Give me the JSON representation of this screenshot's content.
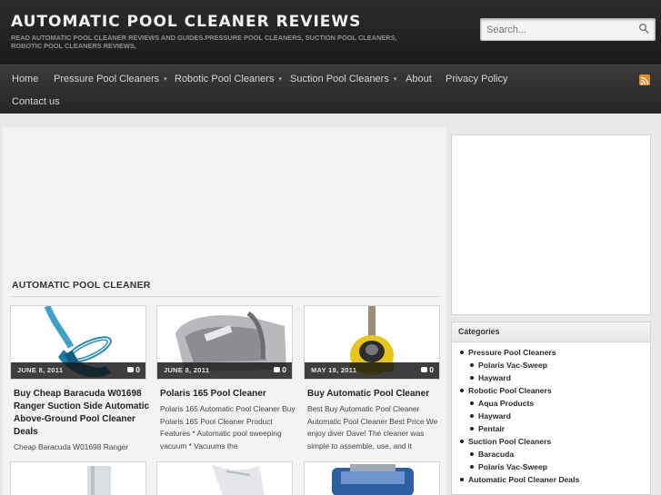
{
  "site": {
    "title": "AUTOMATIC POOL CLEANER REVIEWS",
    "description": "READ AUTOMATIC POOL CLEANER REVIEWS AND GUIDES.PRESSURE POOL CLEANERS, SUCTION POOL CLEANERS, ROBOTIC POOL CLEANERS REVIEWS,"
  },
  "search": {
    "placeholder": "Search..."
  },
  "nav": {
    "items": [
      {
        "label": "Home"
      },
      {
        "label": "Pressure Pool Cleaners"
      },
      {
        "label": "Robotic Pool Cleaners"
      },
      {
        "label": "Suction Pool Cleaners"
      },
      {
        "label": "About"
      },
      {
        "label": "Privacy Policy"
      },
      {
        "label": "Contact us"
      }
    ],
    "dropdown_caret": "▾",
    "rss_icon": "rss-icon"
  },
  "section": {
    "title": "AUTOMATIC POOL CLEANER"
  },
  "posts": [
    {
      "date": "JUNE 8, 2011",
      "comments": "0",
      "title": "Buy Cheap Baracuda W01698 Ranger Suction Side Automatic Above-Ground Pool Cleaner Deals",
      "excerpt": "Cheap Baracuda W01698 Ranger"
    },
    {
      "date": "JUNE 8, 2011",
      "comments": "0",
      "title": "Polaris 165 Pool Cleaner",
      "excerpt": "Polaris 165 Automatic Pool Cleaner Buy Polaris 165 Pool Cleaner Product Features * Automatic pool sweeping vacuum * Vacuums the"
    },
    {
      "date": "MAY 19, 2011",
      "comments": "0",
      "title": "Buy Automatic Pool Cleaner",
      "excerpt": "Best Buy Automatic Pool Cleaner Automatic Pool Cleaner Best Price We enjoy diver Dave! The cleaner was simple to assemble, use, and it"
    }
  ],
  "categories": {
    "heading": "Categories",
    "items": [
      {
        "label": "Pressure Pool Cleaners",
        "level": 0
      },
      {
        "label": "Polaris Vac-Sweep",
        "level": 1
      },
      {
        "label": "Hayward",
        "level": 1
      },
      {
        "label": "Robotic Pool Cleaners",
        "level": 0
      },
      {
        "label": "Aqua Products",
        "level": 1
      },
      {
        "label": "Hayward",
        "level": 1
      },
      {
        "label": "Pentair",
        "level": 1
      },
      {
        "label": "Suction Pool Cleaners",
        "level": 0
      },
      {
        "label": "Baracuda",
        "level": 1
      },
      {
        "label": "Polaris Vac-Sweep",
        "level": 1
      },
      {
        "label": "Automatic Pool Cleaner Deals",
        "level": 0
      }
    ]
  },
  "colors": {
    "header_bg": "#1f1f1f",
    "nav_bg": "#2e2e2e",
    "rss": "#e68a2e"
  }
}
